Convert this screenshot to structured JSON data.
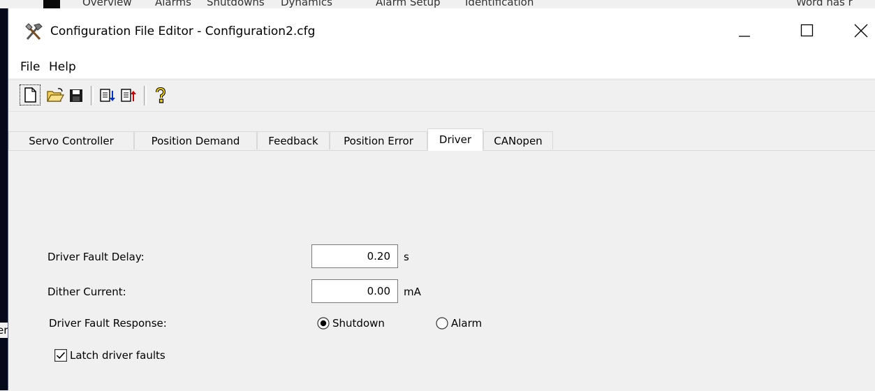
{
  "background_app": {
    "tabs_partial": [
      "Overview",
      "Alarms",
      "Shutdowns",
      "Dynamics",
      "Alarm Setup",
      "Identification"
    ],
    "right_text_partial": "Word has r",
    "left_stub_text": "er"
  },
  "window": {
    "title": "Configuration File Editor - Configuration2.cfg",
    "icon": "tools-icon",
    "controls": {
      "minimize": "minimize-icon",
      "maximize": "maximize-icon",
      "close": "close-icon"
    }
  },
  "menu": {
    "items": [
      "File",
      "Help"
    ]
  },
  "toolbar": {
    "buttons": [
      "new-file-icon",
      "open-folder-icon",
      "save-disk-icon",
      "import-icon",
      "export-icon",
      "help-icon"
    ]
  },
  "tabs": {
    "items": [
      "Servo Controller",
      "Position Demand",
      "Feedback",
      "Position Error",
      "Driver",
      "CANopen"
    ],
    "active": "Driver"
  },
  "driver": {
    "fault_delay": {
      "label": "Driver Fault Delay:",
      "value": "0.20",
      "unit": "s"
    },
    "dither_current": {
      "label": "Dither Current:",
      "value": "0.00",
      "unit": "mA"
    },
    "fault_response": {
      "label": "Driver Fault Response:",
      "options": [
        "Shutdown",
        "Alarm"
      ],
      "selected": "Shutdown"
    },
    "latch_faults": {
      "label": "Latch driver faults",
      "checked": true
    }
  },
  "colors": {
    "window_bg": "#f0f0f0",
    "titlebar_bg": "#ffffff",
    "desktop_dark": "#050a1a"
  }
}
